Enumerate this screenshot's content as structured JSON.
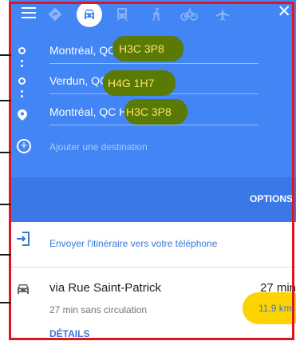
{
  "modes": [
    {
      "name": "best-route",
      "icon": "diamond-turn-icon",
      "glyph": "◆"
    },
    {
      "name": "driving",
      "icon": "car-icon",
      "glyph": "🚘"
    },
    {
      "name": "transit",
      "icon": "train-icon",
      "glyph": "🚆"
    },
    {
      "name": "walking",
      "icon": "walk-icon",
      "glyph": "🚶"
    },
    {
      "name": "cycling",
      "icon": "bike-icon",
      "glyph": "🚲"
    },
    {
      "name": "flight",
      "icon": "plane-icon",
      "glyph": "✈"
    }
  ],
  "stops": [
    {
      "city": "Montréal, QC",
      "postal": "H3C 3P8",
      "full": "Montréal, QC H3C 3P8"
    },
    {
      "city": "Verdun, QC",
      "postal": "H4G 1H7",
      "full": "Verdun, QC H4G 1H7"
    },
    {
      "city": "Montréal, QC",
      "postal": "H3C 3P8",
      "full": "Montréal, QC H3C 3P8"
    }
  ],
  "add_destination": "Ajouter une destination",
  "options_label": "OPTIONS",
  "send_to_phone": "Envoyer l'itinéraire vers votre téléphone",
  "route": {
    "via": "via Rue Saint-Patrick",
    "time": "27 min",
    "no_traffic": "27 min sans circulation",
    "distance": "11,9 km",
    "details": "DÉTAILS"
  },
  "colors": {
    "header_blue": "#4285f4",
    "highlight_olive": "#5a7a06",
    "highlight_text": "#ffe066",
    "distance_badge": "#fdd300",
    "link_blue": "#3a77d6",
    "annotation_red": "#e0161d"
  }
}
